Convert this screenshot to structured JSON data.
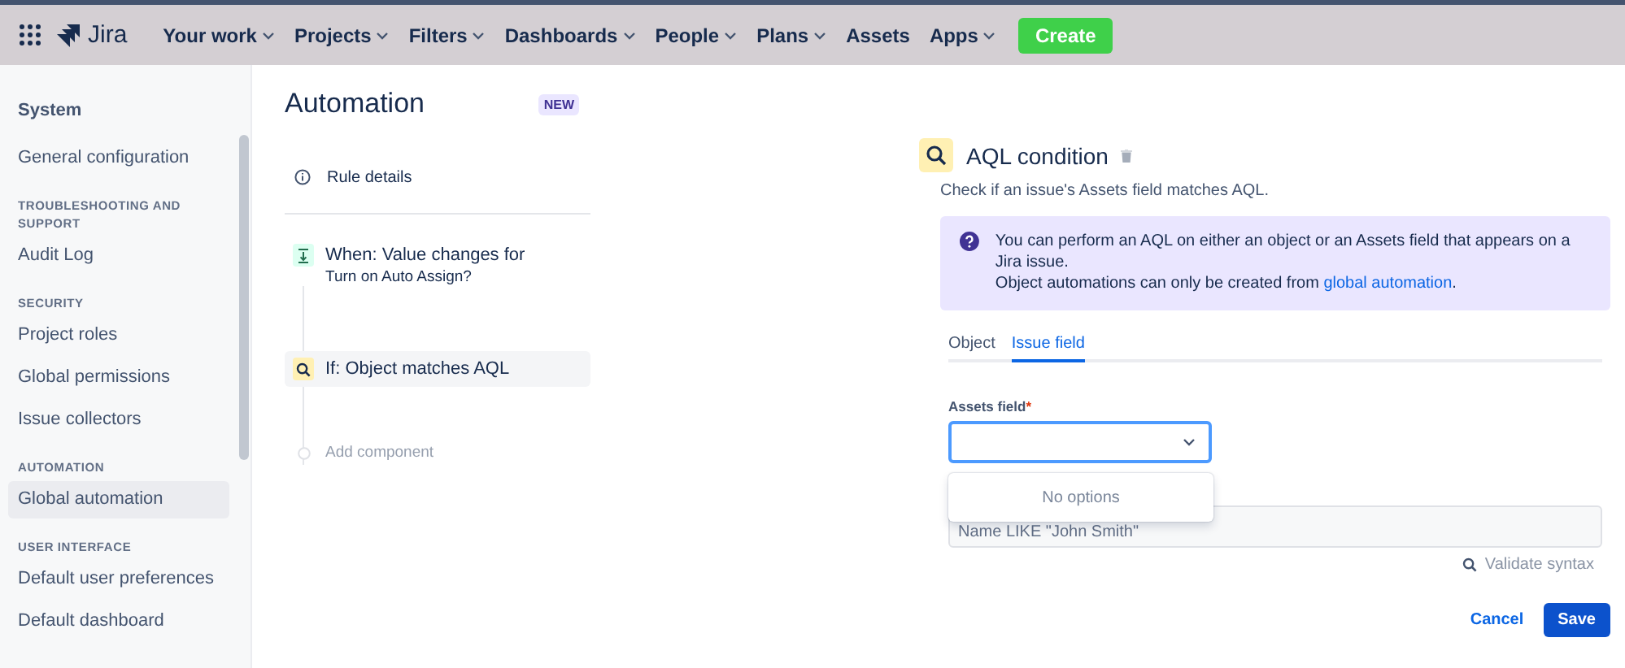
{
  "topnav": {
    "app_name": "Jira",
    "create": "Create",
    "menus": [
      {
        "label": "Your work",
        "dropdown": true
      },
      {
        "label": "Projects",
        "dropdown": true
      },
      {
        "label": "Filters",
        "dropdown": true
      },
      {
        "label": "Dashboards",
        "dropdown": true
      },
      {
        "label": "People",
        "dropdown": true
      },
      {
        "label": "Plans",
        "dropdown": true
      },
      {
        "label": "Assets",
        "dropdown": false
      },
      {
        "label": "Apps",
        "dropdown": true
      }
    ]
  },
  "sidebar": {
    "title": "System",
    "items": [
      {
        "kind": "link",
        "label": "General configuration",
        "selected": false
      },
      {
        "kind": "heading",
        "label": "TROUBLESHOOTING AND SUPPORT"
      },
      {
        "kind": "link",
        "label": "Audit Log",
        "selected": false
      },
      {
        "kind": "heading",
        "label": "SECURITY"
      },
      {
        "kind": "link",
        "label": "Project roles",
        "selected": false
      },
      {
        "kind": "link",
        "label": "Global permissions",
        "selected": false
      },
      {
        "kind": "link",
        "label": "Issue collectors",
        "selected": false
      },
      {
        "kind": "heading",
        "label": "AUTOMATION"
      },
      {
        "kind": "link",
        "label": "Global automation",
        "selected": true
      },
      {
        "kind": "heading",
        "label": "USER INTERFACE"
      },
      {
        "kind": "link",
        "label": "Default user preferences",
        "selected": false
      },
      {
        "kind": "link",
        "label": "Default dashboard",
        "selected": false
      }
    ]
  },
  "automation": {
    "title": "Automation",
    "badge": "NEW",
    "rule_details": "Rule details",
    "steps": [
      {
        "kind": "trigger",
        "title": "When: Value changes for",
        "subtitle": "Turn on Auto Assign?",
        "selected": false
      },
      {
        "kind": "condition",
        "title": "If: Object matches AQL",
        "selected": true
      },
      {
        "kind": "add",
        "title": "Add component",
        "selected": false
      }
    ]
  },
  "condition": {
    "title": "AQL condition",
    "description": "Check if an issue's Assets field matches AQL.",
    "info": {
      "text": "You can perform an AQL on either an object or an Assets field that appears on a Jira issue.",
      "note": "Object automations can only be created from",
      "link": "global automation",
      "note_end": "."
    },
    "tabs": [
      {
        "label": "Object",
        "selected": false
      },
      {
        "label": "Issue field",
        "selected": true
      }
    ],
    "assets_field": {
      "label": "Assets field",
      "required_mark": "*",
      "open": true,
      "menu_message": "No options"
    },
    "aql_field": {
      "placeholder": "Name LIKE \"John Smith\""
    },
    "validate": "Validate syntax",
    "buttons": {
      "cancel": "Cancel",
      "save": "Save"
    }
  }
}
